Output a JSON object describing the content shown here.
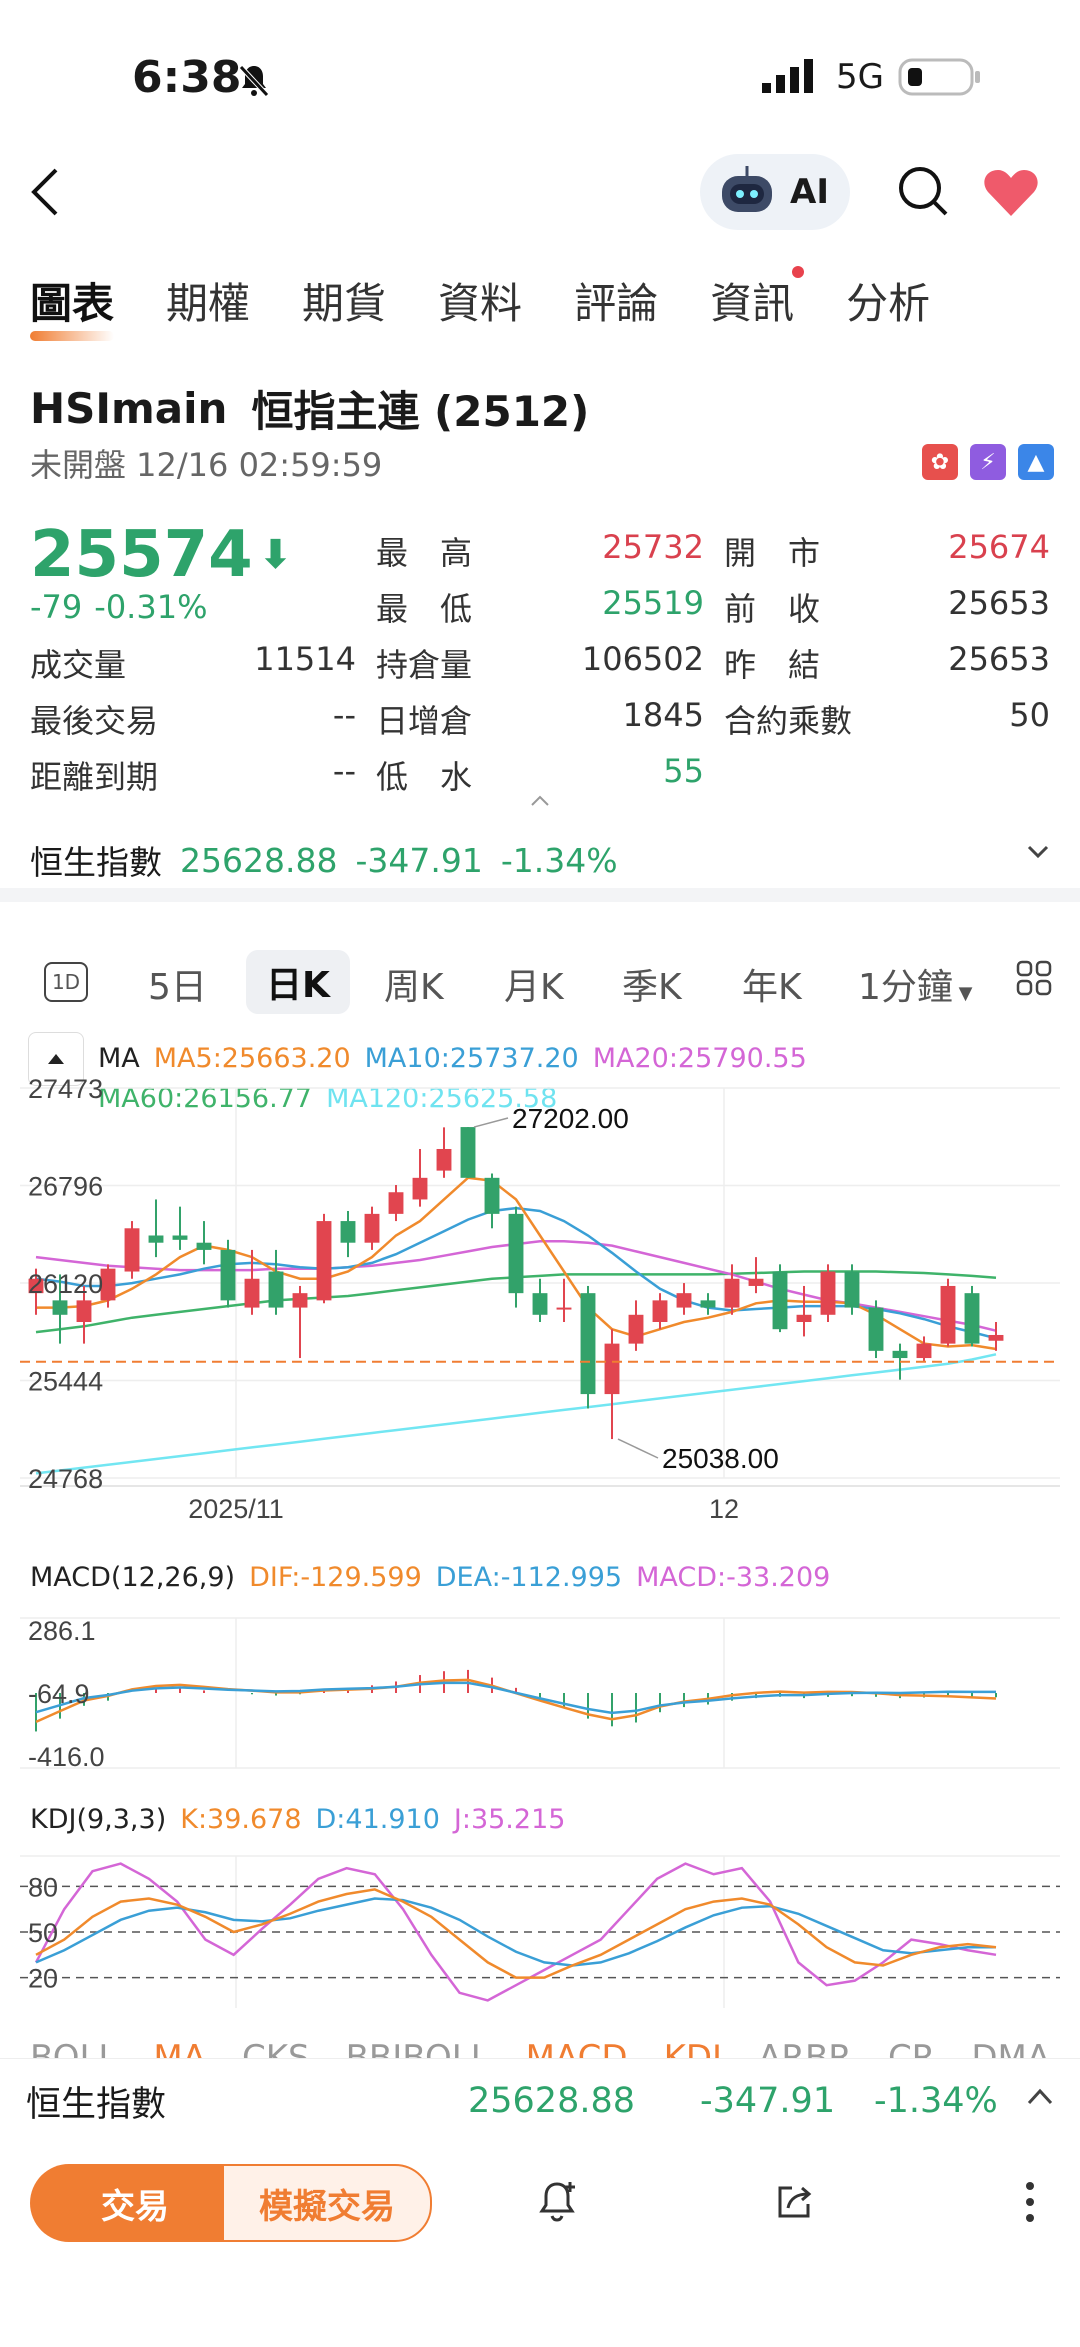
{
  "status": {
    "time": "6:38",
    "network": "5G"
  },
  "header": {
    "ai_label": "AI"
  },
  "tabs": [
    {
      "label": "圖表",
      "active": true
    },
    {
      "label": "期權"
    },
    {
      "label": "期貨"
    },
    {
      "label": "資料"
    },
    {
      "label": "評論"
    },
    {
      "label": "資訊",
      "dot": true
    },
    {
      "label": "分析"
    }
  ],
  "quote": {
    "code": "HSImain",
    "name": "恒指主連 (2512)",
    "status": "未開盤 12/16 02:59:59",
    "price": "25574",
    "change": "-79",
    "change_pct": "-0.31%",
    "fields": {
      "high_label": "最　高",
      "high": "25732",
      "open_label": "開　市",
      "open": "25674",
      "low_label": "最　低",
      "low": "25519",
      "prev_close_label": "前　收",
      "prev_close": "25653",
      "volume_label": "成交量",
      "volume": "11514",
      "oi_label": "持倉量",
      "oi": "106502",
      "settle_label": "昨　結",
      "settle": "25653",
      "last_trade_label": "最後交易",
      "last_trade": "--",
      "oi_change_label": "日增倉",
      "oi_change": "1845",
      "multiplier_label": "合約乘數",
      "multiplier": "50",
      "expiry_label": "距離到期",
      "expiry": "--",
      "discount_label": "低　水",
      "discount": "55"
    }
  },
  "index_strip": {
    "name": "恒生指數",
    "value": "25628.88",
    "change": "-347.91",
    "pct": "-1.34%"
  },
  "period_tabs": [
    "5日",
    "日K",
    "周K",
    "月K",
    "季K",
    "年K",
    "1分鐘"
  ],
  "period_selected": "日K",
  "period_1d_icon": "1D",
  "chart_data": [
    {
      "type": "candlestick",
      "legend": {
        "ma": "MA",
        "ma5": "MA5:25663.20",
        "ma10": "MA10:25737.20",
        "ma20": "MA20:25790.55",
        "ma60": "MA60:26156.77",
        "ma120": "MA120:25625.58"
      },
      "y_ticks": [
        "27473",
        "26796",
        "26120",
        "25444",
        "24768"
      ],
      "x_ticks": [
        "2025/11",
        "12"
      ],
      "ylim": [
        24768,
        27473
      ],
      "max_label": "27202.00",
      "min_label": "25038.00",
      "candles": [
        [
          26050,
          26150,
          25900,
          26220
        ],
        [
          26000,
          25900,
          25700,
          26180
        ],
        [
          25850,
          26000,
          25700,
          26100
        ],
        [
          26000,
          26220,
          25950,
          26250
        ],
        [
          26200,
          26500,
          26150,
          26550
        ],
        [
          26450,
          26400,
          26300,
          26700
        ],
        [
          26450,
          26420,
          26350,
          26650
        ],
        [
          26400,
          26350,
          26250,
          26550
        ],
        [
          26350,
          26000,
          25950,
          26420
        ],
        [
          25950,
          26150,
          25900,
          26350
        ],
        [
          26200,
          25950,
          25900,
          26350
        ],
        [
          25950,
          26050,
          25600,
          26100
        ],
        [
          26000,
          26550,
          25980,
          26600
        ],
        [
          26550,
          26400,
          26300,
          26620
        ],
        [
          26400,
          26600,
          26350,
          26650
        ],
        [
          26600,
          26750,
          26550,
          26800
        ],
        [
          26700,
          26850,
          26650,
          27050
        ],
        [
          26900,
          27050,
          26850,
          27200
        ],
        [
          27202,
          26850,
          26850,
          27202
        ],
        [
          26850,
          26600,
          26500,
          26880
        ],
        [
          26600,
          26050,
          25950,
          26650
        ],
        [
          26050,
          25900,
          25850,
          26150
        ],
        [
          25950,
          25950,
          25850,
          26150
        ],
        [
          26050,
          25350,
          25250,
          26100
        ],
        [
          25350,
          25700,
          25038,
          25800
        ],
        [
          25700,
          25900,
          25650,
          26000
        ],
        [
          25850,
          26000,
          25800,
          26050
        ],
        [
          25950,
          26050,
          25900,
          26120
        ],
        [
          26000,
          25950,
          25900,
          26050
        ],
        [
          25950,
          26150,
          25900,
          26250
        ],
        [
          26100,
          26150,
          26050,
          26300
        ],
        [
          26200,
          25800,
          25780,
          26250
        ],
        [
          25850,
          25900,
          25750,
          26100
        ],
        [
          25900,
          26200,
          25850,
          26250
        ],
        [
          26200,
          25950,
          25900,
          26250
        ],
        [
          25950,
          25650,
          25600,
          26000
        ],
        [
          25650,
          25600,
          25450,
          25700
        ],
        [
          25600,
          25700,
          25580,
          25750
        ],
        [
          25700,
          26100,
          25680,
          26150
        ],
        [
          26050,
          25700,
          25680,
          26100
        ],
        [
          25720,
          25760,
          25650,
          25850
        ]
      ],
      "candle_order": [
        "open",
        "close",
        "low",
        "high"
      ],
      "last_price_line": 25574,
      "ma_series": {
        "ma5": [
          25950,
          25950,
          25960,
          26000,
          26080,
          26180,
          26300,
          26380,
          26350,
          26300,
          26200,
          26150,
          26150,
          26200,
          26300,
          26450,
          26550,
          26700,
          26850,
          26830,
          26700,
          26450,
          26200,
          25950,
          25800,
          25750,
          25800,
          25850,
          25880,
          25920,
          25980,
          26000,
          25990,
          25990,
          25980,
          25900,
          25800,
          25700,
          25680,
          25690,
          25663
        ],
        "ma10": [
          26150,
          26130,
          26100,
          26100,
          26120,
          26150,
          26180,
          26220,
          26250,
          26260,
          26250,
          26230,
          26220,
          26230,
          26260,
          26320,
          26400,
          26480,
          26560,
          26620,
          26640,
          26620,
          26550,
          26450,
          26330,
          26200,
          26080,
          26000,
          25950,
          25930,
          25940,
          25950,
          25960,
          25960,
          25960,
          25940,
          25910,
          25870,
          25820,
          25780,
          25737
        ],
        "ma20": [
          26300,
          26280,
          26260,
          26240,
          26230,
          26220,
          26210,
          26210,
          26210,
          26210,
          26220,
          26220,
          26220,
          26230,
          26240,
          26260,
          26280,
          26310,
          26340,
          26370,
          26390,
          26410,
          26410,
          26400,
          26380,
          26340,
          26300,
          26260,
          26220,
          26180,
          26130,
          26080,
          26040,
          26000,
          25980,
          25950,
          25920,
          25890,
          25860,
          25830,
          25790
        ],
        "ma60": [
          25780,
          25800,
          25820,
          25850,
          25880,
          25900,
          25920,
          25940,
          25960,
          25980,
          26000,
          26010,
          26020,
          26030,
          26050,
          26070,
          26090,
          26110,
          26130,
          26150,
          26160,
          26170,
          26180,
          26180,
          26180,
          26180,
          26180,
          26180,
          26180,
          26185,
          26190,
          26195,
          26200,
          26200,
          26200,
          26200,
          26195,
          26190,
          26180,
          26170,
          26157
        ],
        "ma120": [
          24800,
          24820,
          24840,
          24860,
          24880,
          24900,
          24920,
          24940,
          24960,
          24980,
          25000,
          25020,
          25040,
          25060,
          25080,
          25100,
          25120,
          25140,
          25160,
          25180,
          25200,
          25220,
          25240,
          25260,
          25280,
          25300,
          25320,
          25340,
          25360,
          25380,
          25400,
          25420,
          25440,
          25460,
          25480,
          25500,
          25520,
          25540,
          25560,
          25590,
          25626
        ]
      }
    },
    {
      "type": "macd",
      "label": "MACD(12,26,9)",
      "dif": "DIF:-129.599",
      "dea": "DEA:-112.995",
      "macd": "MACD:-33.209",
      "y_ticks": [
        "286.1",
        "-64.9",
        "-416.0"
      ],
      "ylim": [
        -416.0,
        286.1
      ],
      "hist": [
        -300,
        -200,
        -100,
        -60,
        0,
        30,
        40,
        20,
        0,
        -10,
        -20,
        -10,
        20,
        40,
        60,
        90,
        140,
        170,
        180,
        120,
        40,
        -40,
        -120,
        -200,
        -260,
        -230,
        -150,
        -110,
        -90,
        -60,
        -40,
        -30,
        -40,
        -30,
        -25,
        -30,
        -40,
        -35,
        -30,
        -32,
        -33
      ]
    },
    {
      "type": "kdj",
      "label": "KDJ(9,3,3)",
      "k": "K:39.678",
      "d": "D:41.910",
      "j": "J:35.215",
      "y_ticks": [
        "80",
        "50",
        "20"
      ],
      "ylim": [
        0,
        100
      ],
      "k_series": [
        35,
        45,
        60,
        70,
        72,
        68,
        60,
        50,
        55,
        62,
        70,
        75,
        78,
        70,
        60,
        45,
        30,
        20,
        20,
        28,
        35,
        45,
        55,
        65,
        70,
        72,
        68,
        55,
        40,
        30,
        28,
        35,
        40,
        42,
        40
      ],
      "d_series": [
        30,
        38,
        48,
        58,
        64,
        66,
        63,
        58,
        57,
        59,
        64,
        68,
        72,
        71,
        66,
        58,
        47,
        37,
        30,
        28,
        30,
        36,
        44,
        53,
        61,
        66,
        67,
        62,
        54,
        46,
        38,
        36,
        38,
        40,
        40
      ],
      "j_series": [
        30,
        65,
        90,
        95,
        85,
        70,
        45,
        35,
        52,
        68,
        85,
        92,
        88,
        65,
        35,
        10,
        5,
        15,
        25,
        35,
        45,
        65,
        85,
        95,
        88,
        92,
        70,
        30,
        15,
        18,
        30,
        45,
        42,
        38,
        35
      ]
    }
  ],
  "indicator_tabs": [
    "BOLL",
    "MA",
    "CKS",
    "BBIBOLL",
    "MACD",
    "KDJ",
    "ARBR",
    "CR",
    "DMA"
  ],
  "bottom": {
    "trade": "交易",
    "sim_trade": "模擬交易"
  }
}
